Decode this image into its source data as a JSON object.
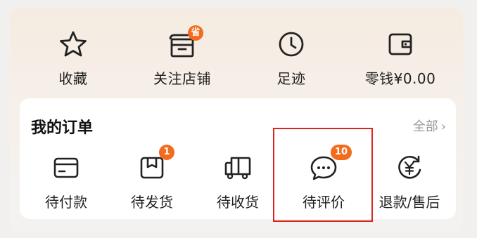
{
  "quick_links": [
    {
      "label": "收藏",
      "icon": "star-icon"
    },
    {
      "label": "关注店铺",
      "icon": "store-icon",
      "badge": "省"
    },
    {
      "label": "足迹",
      "icon": "clock-icon"
    },
    {
      "label": "零钱¥0.00",
      "icon": "wallet-icon"
    }
  ],
  "orders": {
    "title": "我的订单",
    "all_label": "全部",
    "items": [
      {
        "label": "待付款",
        "icon": "card-icon"
      },
      {
        "label": "待发货",
        "icon": "package-icon",
        "badge": "1"
      },
      {
        "label": "待收货",
        "icon": "truck-icon"
      },
      {
        "label": "待评价",
        "icon": "chat-icon",
        "badge": "10"
      },
      {
        "label": "退款/售后",
        "icon": "refund-icon"
      }
    ]
  },
  "colors": {
    "badge": "#f36b1c",
    "highlight": "#d8261e"
  }
}
